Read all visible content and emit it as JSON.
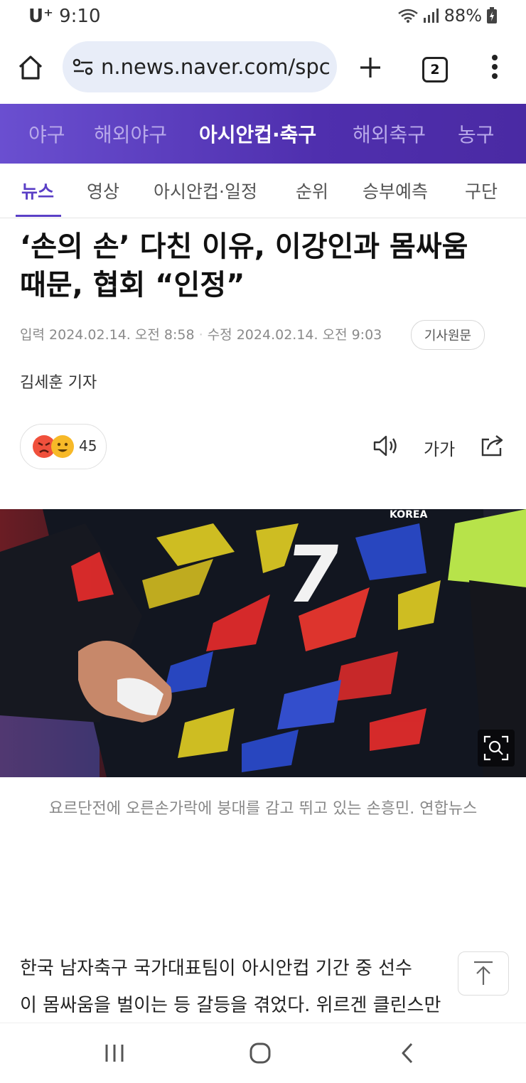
{
  "status_bar": {
    "carrier": "U⁺",
    "time": "9:10",
    "battery": "88%"
  },
  "browser": {
    "url": "n.news.naver.com/spc",
    "tab_count": "2"
  },
  "sport_nav": [
    "야구",
    "해외야구",
    "아시안컵·축구",
    "해외축구",
    "농구"
  ],
  "sub_nav": [
    "뉴스",
    "영상",
    "아시안컵·일정",
    "순위",
    "승부예측",
    "구단"
  ],
  "article": {
    "headline_line1": "‘손의 손’ 다친 이유, 이강인과 몸싸움",
    "headline_line2": "때문, 협회 “인정”",
    "input_label": "입력",
    "input_time": "2024.02.14. 오전 8:58",
    "edit_label": "수정",
    "edit_time": "2024.02.14. 오전 9:03",
    "original_button": "기사원문",
    "reporter": "김세훈 기자",
    "reaction_count": "45",
    "font_size_label": "가가",
    "caption": "요르단전에 오른손가락에 붕대를 감고 뛰고 있는 손흥민. 연합뉴스",
    "body_line1": "한국 남자축구 국가대표팀이 아시안컵 기간 중 선수",
    "body_line2": "이 몸싸움을 벌이는 등 갈등을 겪었다. 위르겐 클린스만",
    "jersey_text": "KOREA",
    "jersey_number": "7"
  },
  "colors": {
    "nav_purple": "#5a3fc6",
    "status_text": "#333333"
  },
  "icons": [
    "home-icon",
    "site-settings-icon",
    "new-tab-icon",
    "tabs-icon",
    "more-vert-icon",
    "angry-emoji-icon",
    "smile-emoji-icon",
    "speaker-icon",
    "share-icon",
    "zoom-icon",
    "scroll-top-icon",
    "recent-apps-icon",
    "home-nav-icon",
    "back-icon"
  ]
}
